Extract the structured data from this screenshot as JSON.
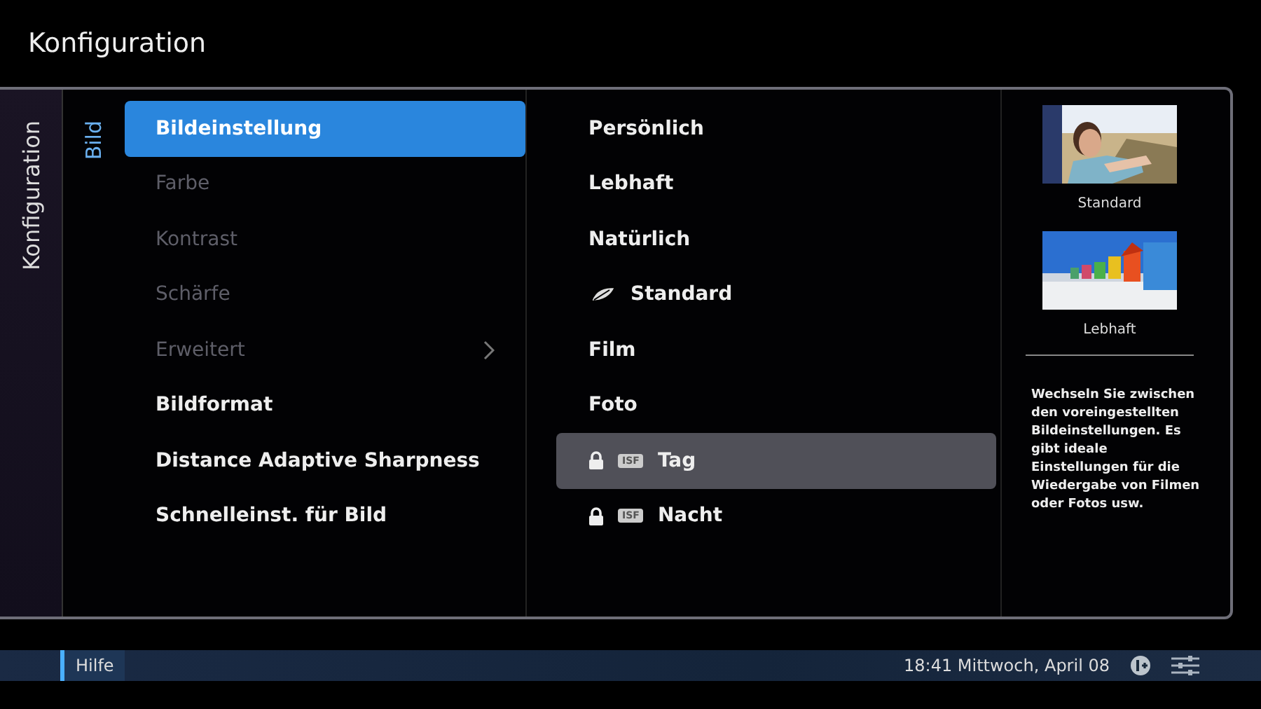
{
  "window": {
    "title": "Konfiguration"
  },
  "breadcrumbs": [
    "Konfiguration",
    "Bild"
  ],
  "menu": [
    {
      "label": "Bildeinstellung",
      "selected": true,
      "disabled": false,
      "submenu": false
    },
    {
      "label": "Farbe",
      "selected": false,
      "disabled": true,
      "submenu": false
    },
    {
      "label": "Kontrast",
      "selected": false,
      "disabled": true,
      "submenu": false
    },
    {
      "label": "Schärfe",
      "selected": false,
      "disabled": true,
      "submenu": false
    },
    {
      "label": "Erweitert",
      "selected": false,
      "disabled": true,
      "submenu": true
    },
    {
      "label": "Bildformat",
      "selected": false,
      "disabled": false,
      "submenu": false
    },
    {
      "label": "Distance Adaptive Sharpness",
      "selected": false,
      "disabled": false,
      "submenu": false
    },
    {
      "label": "Schnelleinst. für Bild",
      "selected": false,
      "disabled": false,
      "submenu": false
    }
  ],
  "options": [
    {
      "label": "Persönlich",
      "kind": "plain",
      "selected": false
    },
    {
      "label": "Lebhaft",
      "kind": "plain",
      "selected": false
    },
    {
      "label": "Natürlich",
      "kind": "plain",
      "selected": false
    },
    {
      "label": "Standard",
      "kind": "eco",
      "selected": false
    },
    {
      "label": "Film",
      "kind": "plain",
      "selected": false
    },
    {
      "label": "Foto",
      "kind": "plain",
      "selected": false
    },
    {
      "label": "Tag",
      "kind": "isf",
      "badge": "ISF",
      "selected": true
    },
    {
      "label": "Nacht",
      "kind": "isf",
      "badge": "ISF",
      "selected": false
    }
  ],
  "previews": [
    {
      "kind": "picture",
      "caption": "Standard"
    },
    {
      "kind": "picture",
      "caption": "Lebhaft"
    }
  ],
  "help_text": "Wechseln Sie zwischen den voreingestellten Bildeinstellungen. Es gibt ideale Einstellungen für die Wiedergabe von Filmen oder Fotos usw.",
  "status_bar": {
    "help": "Hilfe",
    "clock": "18:41 Mittwoch, April 08"
  }
}
